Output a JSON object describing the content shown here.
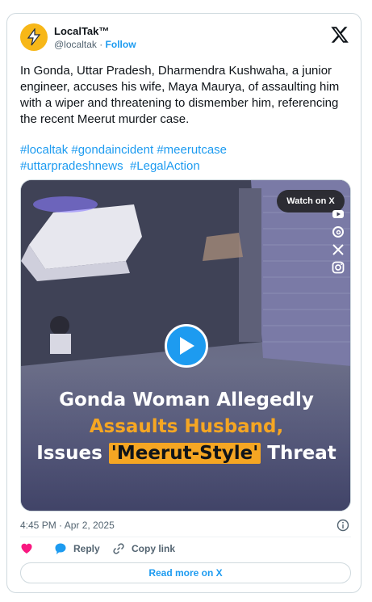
{
  "account": {
    "display_name": "LocalTak™",
    "handle": "@localtak",
    "separator": " · ",
    "follow_label": "Follow"
  },
  "tweet": {
    "text": "In Gonda, Uttar Pradesh, Dharmendra Kushwaha, a junior engineer, accuses his wife, Maya Maurya, of assaulting him with a wiper and threatening to dismember him, referencing the recent Meerut murder case.",
    "hashtags_line1": [
      "#localtak",
      "#gondaincident",
      "#meerutcase"
    ],
    "hashtags_line2": [
      "#uttarpradeshnews",
      "#LegalAction"
    ]
  },
  "media": {
    "watch_label": "Watch on X",
    "overlay_line1": "Gonda Woman Allegedly",
    "overlay_line2": "Assaults Husband,",
    "overlay_line3_before": "Issues ",
    "overlay_line3_highlight": "'Meerut-Style'",
    "overlay_line3_after": " Threat",
    "side_icons": [
      "youtube-icon",
      "threads-icon",
      "x-icon",
      "instagram-icon"
    ]
  },
  "meta": {
    "timestamp": "4:45 PM · Apr 2, 2025"
  },
  "actions": {
    "reply_label": "Reply",
    "copy_label": "Copy link",
    "read_more_label": "Read more on X"
  },
  "colors": {
    "accent": "#1d9bf0",
    "like": "#f91880",
    "highlight": "#f5a623"
  }
}
